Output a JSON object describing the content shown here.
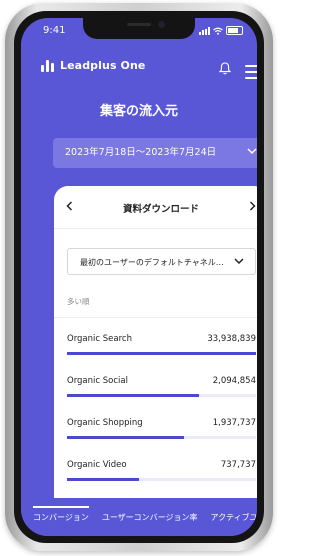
{
  "status_bar": {
    "time": "9:41"
  },
  "header": {
    "logo_text": "Leadplus One"
  },
  "page": {
    "title": "集客の流入元"
  },
  "date_range": {
    "label": "2023年7月18日〜2023年7月24日"
  },
  "card": {
    "title": "資料ダウンロード",
    "dropdown_value": "最初のユーザーのデフォルトチャネル…",
    "sort_label": "多い順",
    "rows": [
      {
        "name": "Organic Search",
        "value": "33,938,839",
        "level": 1.0
      },
      {
        "name": "Organic Social",
        "value": "2,094,854",
        "level": 0.7
      },
      {
        "name": "Organic Shopping",
        "value": "1,937,737",
        "level": 0.62
      },
      {
        "name": "Organic Video",
        "value": "737,737",
        "level": 0.38
      }
    ]
  },
  "bottom_tabs": [
    {
      "label": "コンバージョン"
    },
    {
      "label": "ユーザーコンバージョン率"
    },
    {
      "label": "アクティブユー"
    }
  ],
  "colors": {
    "accent": "#5a57d7",
    "bar": "#4d49cc"
  }
}
